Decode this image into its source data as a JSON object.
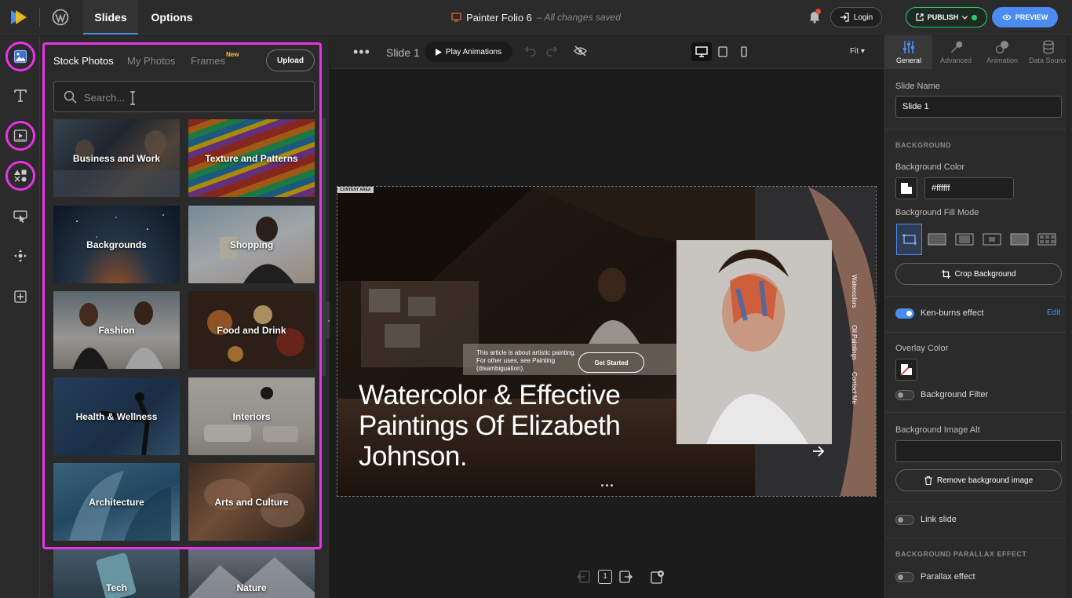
{
  "topbar": {
    "tabs": [
      {
        "label": "Slides"
      },
      {
        "label": "Options"
      }
    ],
    "doc_name": "Painter Folio 6",
    "save_status": "– All changes saved",
    "login": "Login",
    "publish": "PUBLISH",
    "preview": "PREVIEW"
  },
  "panel": {
    "tabs": [
      {
        "label": "Stock Photos"
      },
      {
        "label": "My Photos"
      },
      {
        "label": "Frames"
      }
    ],
    "new_badge": "New",
    "upload": "Upload",
    "search_placeholder": "Search...",
    "categories": [
      {
        "label": "Business and Work"
      },
      {
        "label": "Texture and Patterns"
      },
      {
        "label": "Backgrounds"
      },
      {
        "label": "Shopping"
      },
      {
        "label": "Fashion"
      },
      {
        "label": "Food and Drink"
      },
      {
        "label": "Health & Wellness"
      },
      {
        "label": "Interiors"
      },
      {
        "label": "Architecture"
      },
      {
        "label": "Arts and Culture"
      },
      {
        "label": "Tech"
      },
      {
        "label": "Nature"
      }
    ]
  },
  "canvas": {
    "slide_label": "Slide 1",
    "play_animations": "Play Animations",
    "fit": "Fit",
    "content_area": "CONTENT AREA",
    "small_text": "This article is about artistic painting. For other uses, see Painting (disambiguation).",
    "get_started": "Get Started",
    "headline": "Watercolor & Effective Paintings Of Elizabeth Johnson.",
    "vertical_links": [
      {
        "label": "Watercolors"
      },
      {
        "label": "Oil Paintings"
      },
      {
        "label": "Contact Me"
      }
    ],
    "page_number": "1"
  },
  "right_panel": {
    "tabs": [
      {
        "label": "General"
      },
      {
        "label": "Advanced"
      },
      {
        "label": "Animation"
      },
      {
        "label": "Data Source"
      }
    ],
    "slide_name_label": "Slide Name",
    "slide_name_value": "Slide 1",
    "background_section": "BACKGROUND",
    "bg_color_label": "Background Color",
    "bg_color_value": "#ffffff",
    "fill_mode_label": "Background Fill Mode",
    "crop_background": "Crop Background",
    "ken_burns": "Ken-burns effect",
    "edit": "Edit",
    "overlay_color": "Overlay Color",
    "background_filter": "Background Filter",
    "image_alt_label": "Background Image Alt",
    "image_alt_value": "",
    "remove_bg": "Remove background image",
    "link_slide": "Link slide",
    "parallax_section": "BACKGROUND PARALLAX EFFECT",
    "parallax_effect": "Parallax effect"
  },
  "colors": {
    "accent": "#4a8cf0",
    "publish_green": "#2ecc71",
    "highlight_magenta": "#e834e6"
  }
}
